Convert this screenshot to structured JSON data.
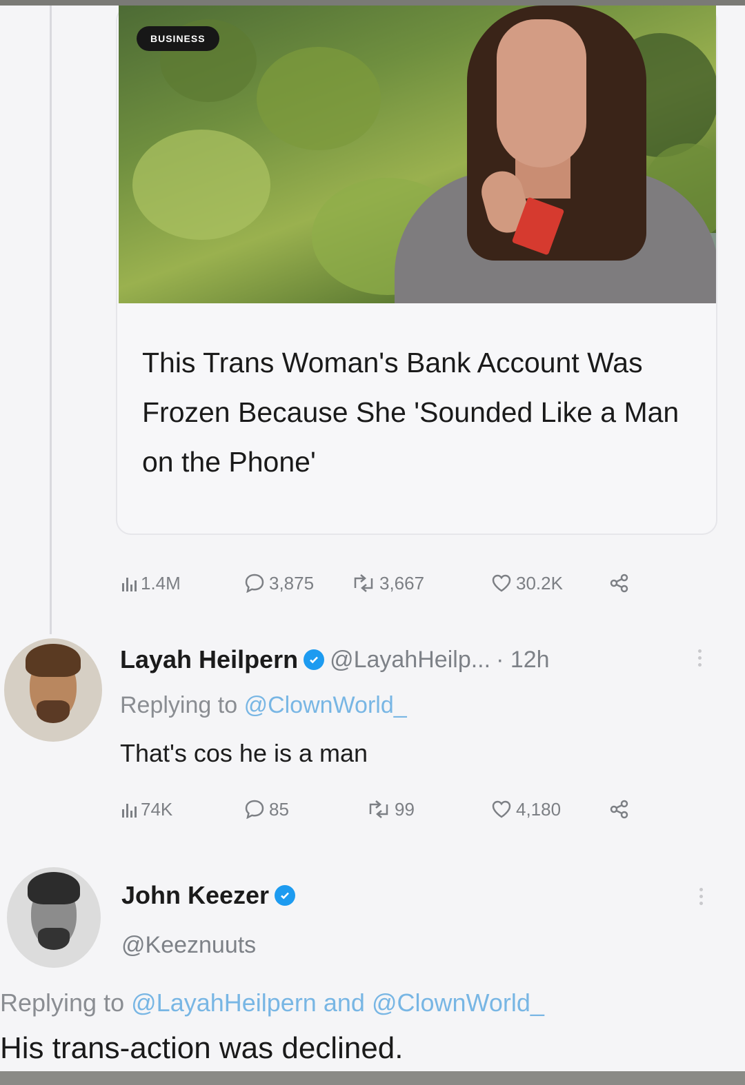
{
  "article": {
    "badge": "BUSINESS",
    "headline": "This Trans Woman's Bank Account Was Frozen Because She 'Sounded Like a Man on the Phone'"
  },
  "post_stats": {
    "views": "1.4M",
    "replies": "3,875",
    "reposts": "3,667",
    "likes": "30.2K"
  },
  "reply_1": {
    "name": "Layah Heilpern",
    "handle": "@LayahHeilp...",
    "time": "· 12h",
    "replying_prefix": "Replying to",
    "replying_to": "@ClownWorld_",
    "text": "That's cos he is a man",
    "stats": {
      "views": "74K",
      "replies": "85",
      "reposts": "99",
      "likes": "4,180"
    }
  },
  "reply_2": {
    "name": "John Keezer",
    "handle": "@Keeznuuts",
    "replying_prefix": "Replying to",
    "replying_to_1": "@LayahHeilpern",
    "replying_and": "and",
    "replying_to_2": "@ClownWorld_",
    "text": "His trans-action was declined."
  },
  "colors": {
    "verified": "#1d9bf0",
    "mention": "#78b6e4",
    "stat_gray": "#7c7f84"
  },
  "icons": {
    "views": "bar-chart-icon",
    "replies": "speech-bubble-icon",
    "reposts": "repost-arrows-icon",
    "likes": "heart-icon",
    "share": "share-icon",
    "verified": "verified-badge-icon"
  }
}
